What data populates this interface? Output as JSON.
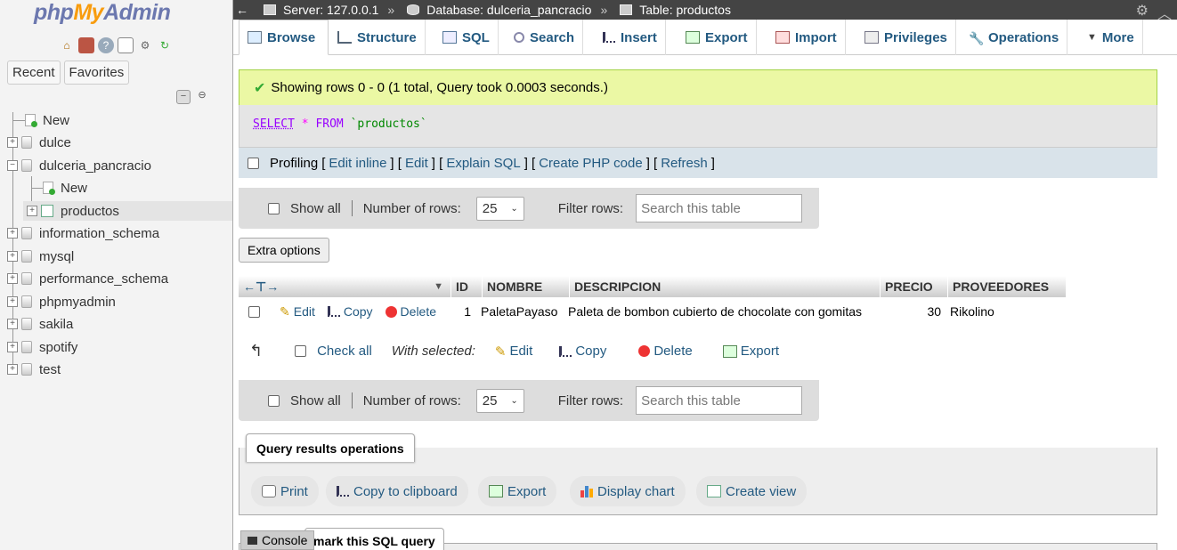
{
  "sidebar": {
    "logo": {
      "php": "php",
      "my": "My",
      "admin": "Admin"
    },
    "tabs": [
      "Recent",
      "Favorites"
    ],
    "tree": [
      {
        "label": "New",
        "type": "new",
        "level": 0
      },
      {
        "label": "dulce",
        "type": "db",
        "level": 0
      },
      {
        "label": "dulceria_pancracio",
        "type": "db",
        "level": 0,
        "expanded": true
      },
      {
        "label": "New",
        "type": "new",
        "level": 1
      },
      {
        "label": "productos",
        "type": "table",
        "level": 1
      },
      {
        "label": "information_schema",
        "type": "db",
        "level": 0
      },
      {
        "label": "mysql",
        "type": "db",
        "level": 0
      },
      {
        "label": "performance_schema",
        "type": "db",
        "level": 0
      },
      {
        "label": "phpmyadmin",
        "type": "db",
        "level": 0
      },
      {
        "label": "sakila",
        "type": "db",
        "level": 0
      },
      {
        "label": "spotify",
        "type": "db",
        "level": 0
      },
      {
        "label": "test",
        "type": "db",
        "level": 0
      }
    ]
  },
  "breadcrumb": {
    "server": "Server: 127.0.0.1",
    "database": "Database: dulceria_pancracio",
    "table": "Table: productos",
    "separator": "»"
  },
  "menu": {
    "tabs": [
      "Browse",
      "Structure",
      "SQL",
      "Search",
      "Insert",
      "Export",
      "Import",
      "Privileges",
      "Operations",
      "More"
    ],
    "active": "Browse"
  },
  "result": {
    "message": "Showing rows 0 - 0 (1 total, Query took 0.0003 seconds.)",
    "sql": {
      "select": "SELECT",
      "star": "*",
      "from": "FROM",
      "table": "`productos`"
    }
  },
  "profiling": {
    "label": "Profiling",
    "links": [
      "Edit inline",
      "Edit",
      "Explain SQL",
      "Create PHP code",
      "Refresh"
    ]
  },
  "nav": {
    "show_all": "Show all",
    "num_rows_label": "Number of rows:",
    "num_rows_value": "25",
    "filter_label": "Filter rows:",
    "filter_placeholder": "Search this table"
  },
  "extra_options": "Extra options",
  "table": {
    "columns": [
      "ID",
      "NOMBRE",
      "DESCRIPCION",
      "PRECIO",
      "PROVEEDORES"
    ],
    "rows": [
      {
        "id": "1",
        "nombre": "PaletaPayaso",
        "descripcion": "Paleta de bombon cubierto de chocolate con gomitas",
        "precio": "30",
        "proveedores": "Rikolino"
      }
    ],
    "row_actions": {
      "edit": "Edit",
      "copy": "Copy",
      "delete": "Delete"
    }
  },
  "with_selected": {
    "check_all": "Check all",
    "label": "With selected:",
    "edit": "Edit",
    "copy": "Copy",
    "delete": "Delete",
    "export": "Export"
  },
  "query_ops": {
    "title": "Query results operations",
    "buttons": [
      "Print",
      "Copy to clipboard",
      "Export",
      "Display chart",
      "Create view"
    ]
  },
  "bookmark": "mark this SQL query",
  "console": "Console",
  "colors": {
    "link": "#235a81",
    "success_bg": "#ebf8a4",
    "topbar": "#444444"
  }
}
